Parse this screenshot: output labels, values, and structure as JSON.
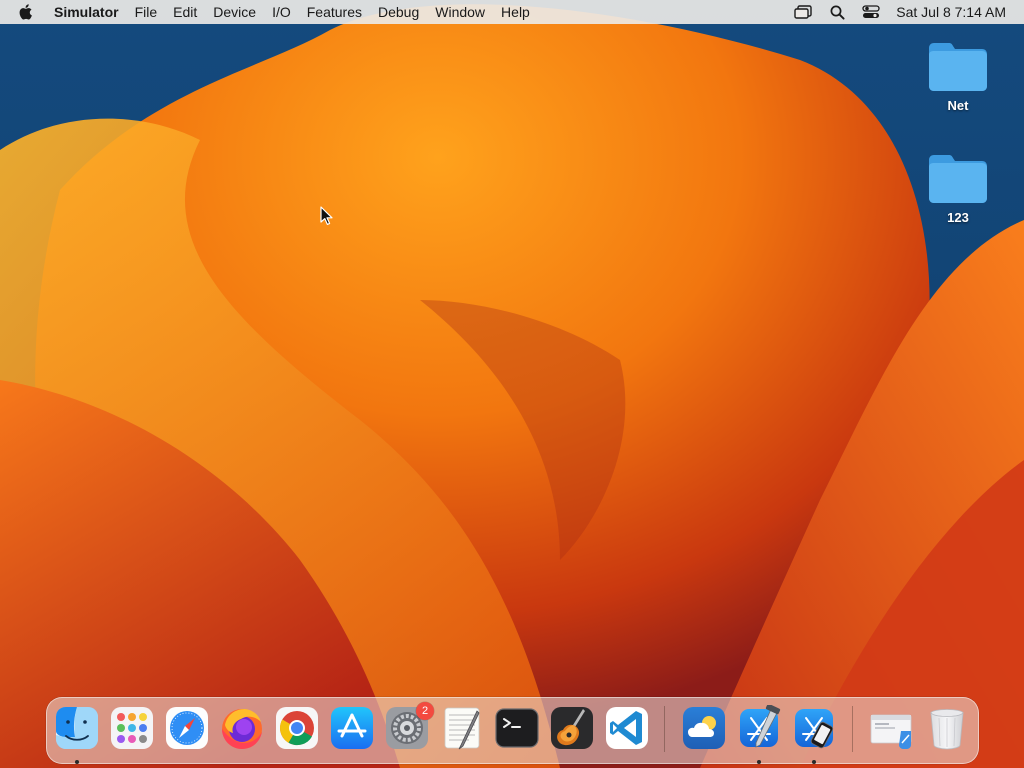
{
  "menubar": {
    "app_name": "Simulator",
    "items": [
      "File",
      "Edit",
      "Device",
      "I/O",
      "Features",
      "Debug",
      "Window",
      "Help"
    ],
    "clock": "Sat Jul 8  7:14 AM"
  },
  "desktop": {
    "icons": [
      {
        "label": "Net"
      },
      {
        "label": "123"
      }
    ]
  },
  "dock": {
    "apps": [
      {
        "icon": "finder-icon",
        "running": true
      },
      {
        "icon": "launchpad-icon",
        "running": false
      },
      {
        "icon": "safari-icon",
        "running": false
      },
      {
        "icon": "firefox-icon",
        "running": false
      },
      {
        "icon": "chrome-icon",
        "running": false
      },
      {
        "icon": "app-store-icon",
        "running": false
      },
      {
        "icon": "system-settings-icon",
        "running": false,
        "badge": "2"
      },
      {
        "icon": "textedit-icon",
        "running": false
      },
      {
        "icon": "terminal-icon",
        "running": false
      },
      {
        "icon": "garageband-icon",
        "running": false
      },
      {
        "icon": "vscode-icon",
        "running": false
      },
      {
        "icon": "weather-icon",
        "running": false
      },
      {
        "icon": "xcode-icon",
        "running": true
      },
      {
        "icon": "simulator-icon",
        "running": true
      },
      {
        "icon": "downloads-stack-icon",
        "running": false
      },
      {
        "icon": "trash-icon",
        "running": false
      }
    ]
  },
  "colors": {
    "accent_orange": "#f28a1e",
    "folder_blue": "#5ab4f0",
    "wallpaper_blue": "#1b4a7a"
  }
}
